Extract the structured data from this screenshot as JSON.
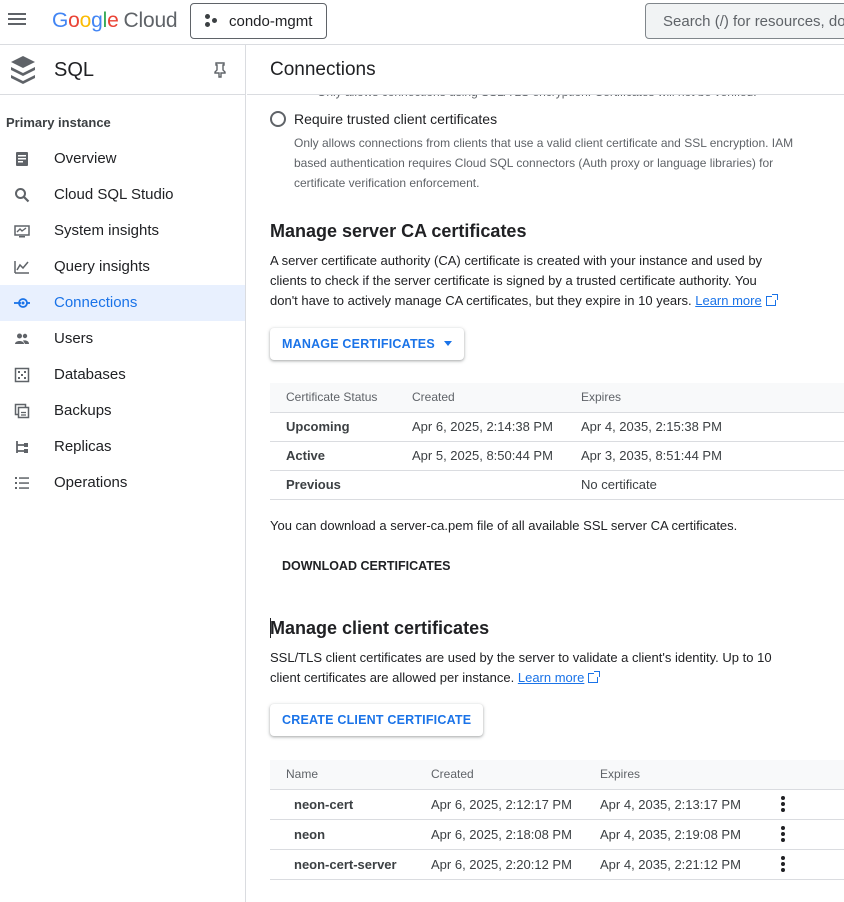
{
  "topbar": {
    "logo_google": [
      "G",
      "o",
      "o",
      "g",
      "l",
      "e"
    ],
    "logo_cloud": "Cloud",
    "project": "condo-mgmt",
    "search_placeholder": "Search (/) for resources, docs"
  },
  "sidebar": {
    "title": "SQL",
    "section": "Primary instance",
    "items": [
      {
        "label": "Overview",
        "icon": "overview-icon"
      },
      {
        "label": "Cloud SQL Studio",
        "icon": "search-icon"
      },
      {
        "label": "System insights",
        "icon": "monitor-icon"
      },
      {
        "label": "Query insights",
        "icon": "chart-icon"
      },
      {
        "label": "Connections",
        "icon": "connections-icon",
        "active": true
      },
      {
        "label": "Users",
        "icon": "users-icon"
      },
      {
        "label": "Databases",
        "icon": "database-icon"
      },
      {
        "label": "Backups",
        "icon": "backup-icon"
      },
      {
        "label": "Replicas",
        "icon": "replica-icon"
      },
      {
        "label": "Operations",
        "icon": "list-icon"
      }
    ]
  },
  "main": {
    "title": "Connections",
    "cut_text": "Only allows connections using SSL/TLS encryption. Certificates will not be verified.",
    "radio_label": "Require trusted client certificates",
    "radio_desc": "Only allows connections from clients that use a valid client certificate and SSL encryption. IAM based authentication requires Cloud SQL connectors (Auth proxy or language libraries) for certificate verification enforcement.",
    "server_ca": {
      "heading": "Manage server CA certificates",
      "para": "A server certificate authority (CA) certificate is created with your instance and used by clients to check if the server certificate is signed by a trusted certificate authority. You don't have to actively manage CA certificates, but they expire in 10 years.",
      "learn_more": "Learn more",
      "manage_button": "MANAGE CERTIFICATES",
      "columns": [
        "Certificate Status",
        "Created",
        "Expires"
      ],
      "rows": [
        {
          "status": "Upcoming",
          "created": "Apr 6, 2025, 2:14:38 PM",
          "expires": "Apr 4, 2035, 2:15:38 PM"
        },
        {
          "status": "Active",
          "created": "Apr 5, 2025, 8:50:44 PM",
          "expires": "Apr 3, 2035, 8:51:44 PM"
        },
        {
          "status": "Previous",
          "created": "",
          "expires": "No certificate"
        }
      ],
      "download_note": "You can download a server-ca.pem file of all available SSL server CA certificates.",
      "download_button": "DOWNLOAD CERTIFICATES"
    },
    "client": {
      "heading": "Manage client certificates",
      "para": "SSL/TLS client certificates are used by the server to validate a client's identity. Up to 10 client certificates are allowed per instance.",
      "learn_more": "Learn more",
      "create_button": "CREATE CLIENT CERTIFICATE",
      "columns": [
        "Name",
        "Created",
        "Expires"
      ],
      "rows": [
        {
          "name": "neon-cert",
          "created": "Apr 6, 2025, 2:12:17 PM",
          "expires": "Apr 4, 2035, 2:13:17 PM"
        },
        {
          "name": "neon",
          "created": "Apr 6, 2025, 2:18:08 PM",
          "expires": "Apr 4, 2035, 2:19:08 PM"
        },
        {
          "name": "neon-cert-server",
          "created": "Apr 6, 2025, 2:20:12 PM",
          "expires": "Apr 4, 2035, 2:21:12 PM"
        }
      ]
    }
  }
}
